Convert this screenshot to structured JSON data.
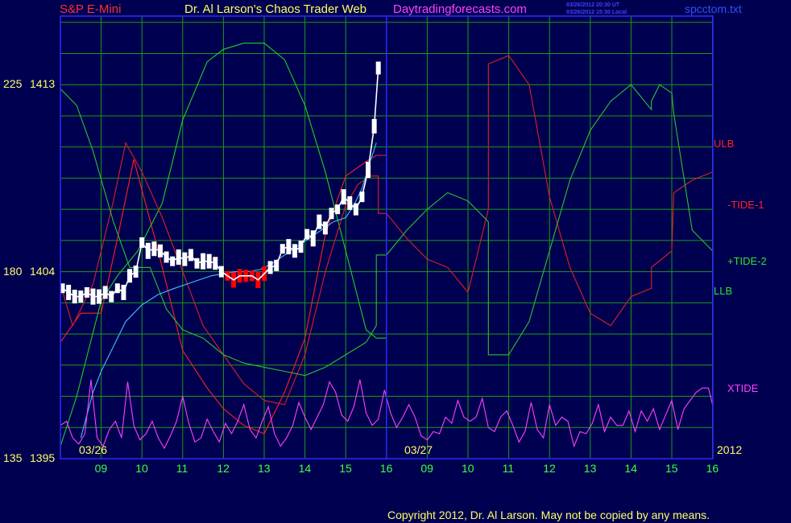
{
  "header": {
    "instrument": "S&P E-Mini",
    "title": "Dr. Al Larson's Chaos Trader Web",
    "site": "Daytradingforecasts.com",
    "stamp_ut": "03/26/2012 20:30 UT",
    "stamp_local": "03/26/2012 15:30 Local",
    "filename": "spcctom.txt"
  },
  "footer": {
    "copyright": "Copyright 2012, Dr. Al Larson. May not be copied by any means."
  },
  "colors": {
    "background": "#000050",
    "grid": "#1a9a1a",
    "frame": "#2a2aff",
    "price": "#ffffff",
    "price_down": "#ff0000",
    "ulb": "#ff2020",
    "llb": "#20d020",
    "tide_minus_1": "#dd2020",
    "tide_plus_2": "#30c030",
    "xtide": "#ff40ff",
    "average": "#40c0ff",
    "day_label": "#ffff66",
    "hour_label": "#40ff40"
  },
  "chart_data": {
    "type": "line",
    "title": "S&P E-Mini",
    "y_axis": {
      "ticks": [
        {
          "left": "225",
          "right": "1413",
          "value": 1413
        },
        {
          "left": "180",
          "right": "1404",
          "value": 1404
        },
        {
          "left": "135",
          "right": "1395",
          "value": 1395
        }
      ],
      "ylim": [
        1395,
        1416.3
      ]
    },
    "x_axis": {
      "hour_ticks": [
        "09",
        "10",
        "11",
        "12",
        "13",
        "14",
        "15",
        "16",
        "09",
        "10",
        "11",
        "12",
        "13",
        "14",
        "15",
        "16"
      ],
      "day_labels": [
        "03/26",
        "03/27"
      ],
      "year_label": "2012",
      "x_range": [
        0,
        16
      ]
    },
    "grid": true,
    "series_labels": {
      "ulb": "ULB",
      "tide_minus_1": "-TIDE-1",
      "tide_plus_2": "+TIDE-2",
      "llb": "LLB",
      "xtide": "XTIDE"
    },
    "series": [
      {
        "key": "ulb",
        "x": [
          0,
          0.5,
          1.0,
          1.4,
          1.8,
          2.4,
          3.0,
          3.6,
          4.0,
          4.5,
          5.0,
          5.5,
          6.0,
          6.5,
          7.0,
          7.5,
          7.75,
          8.0
        ],
        "y": [
          1400.6,
          1402.0,
          1402.0,
          1405.6,
          1409.4,
          1405.0,
          1400.2,
          1398.4,
          1397.4,
          1396.6,
          1396.2,
          1398.2,
          1400.8,
          1405.8,
          1408.6,
          1409.3,
          1409.6,
          1409.6
        ]
      },
      {
        "key": "llb",
        "x": [
          0,
          0.4,
          1.0,
          1.4,
          1.9,
          2.5,
          3.0,
          3.6,
          4.0,
          4.5,
          5.0,
          5.5,
          6.0,
          6.5,
          7.0,
          7.5,
          7.75,
          8.0
        ],
        "y": [
          1395.6,
          1398.0,
          1402.6,
          1403.8,
          1405.0,
          1407.3,
          1411.3,
          1414.1,
          1414.7,
          1415.0,
          1415.0,
          1414.2,
          1412.0,
          1408.8,
          1405.0,
          1401.2,
          1400.8,
          1400.8
        ]
      },
      {
        "key": "tide_minus_1",
        "x": [
          0,
          0.3,
          0.8,
          1.3,
          1.6,
          2.0,
          2.5,
          3.0,
          3.5,
          4.0,
          4.5,
          5.0,
          5.5,
          6.0,
          6.5,
          7.0,
          7.3,
          7.6,
          7.8,
          7.8,
          8.0,
          8.5,
          9.0,
          9.5,
          10.0,
          10.5,
          10.5,
          11.0,
          11.5,
          12.0,
          12.5,
          13.0,
          13.5,
          14.0,
          14.5,
          14.5,
          15.0,
          15.05,
          15.5,
          16.0
        ],
        "y": [
          1403.4,
          1401.4,
          1403.4,
          1407.4,
          1410.2,
          1408.8,
          1406.6,
          1404.0,
          1401.4,
          1400.0,
          1398.6,
          1397.8,
          1397.6,
          1400.0,
          1404.0,
          1407.2,
          1408.2,
          1408.6,
          1408.6,
          1406.8,
          1406.8,
          1405.6,
          1404.6,
          1404.2,
          1403.0,
          1407.0,
          1414.0,
          1414.4,
          1413.0,
          1407.6,
          1404.2,
          1402.0,
          1401.4,
          1402.8,
          1403.2,
          1404.2,
          1405.0,
          1407.8,
          1408.4,
          1408.8
        ]
      },
      {
        "key": "tide_plus_2",
        "x": [
          0,
          0.4,
          0.8,
          1.3,
          1.7,
          2.2,
          2.6,
          3.0,
          3.5,
          4.0,
          4.5,
          5.0,
          5.5,
          6.0,
          6.5,
          7.0,
          7.5,
          7.75,
          7.75,
          8.0,
          8.5,
          9.0,
          9.5,
          10.0,
          10.5,
          10.5,
          11.0,
          11.5,
          12.0,
          12.5,
          13.0,
          13.5,
          14.0,
          14.5,
          14.5,
          14.7,
          15.0,
          15.05,
          15.5,
          16.0
        ],
        "y": [
          1412.8,
          1412.0,
          1409.8,
          1406.4,
          1404.2,
          1404.2,
          1402.2,
          1401.2,
          1400.8,
          1400.0,
          1399.6,
          1399.4,
          1399.2,
          1399.0,
          1399.4,
          1400.0,
          1400.6,
          1401.4,
          1404.8,
          1404.8,
          1406.0,
          1407.0,
          1407.8,
          1407.4,
          1406.4,
          1400.0,
          1400.0,
          1401.6,
          1405.0,
          1408.4,
          1410.8,
          1412.2,
          1413.0,
          1411.8,
          1412.2,
          1413.0,
          1412.6,
          1411.6,
          1406.0,
          1405.0
        ]
      },
      {
        "key": "average",
        "x": [
          0.5,
          0.8,
          1.0,
          1.3,
          1.6,
          2.0,
          2.4,
          2.8,
          3.1,
          3.4,
          3.7,
          4.0,
          4.3,
          4.6,
          4.9,
          5.2,
          5.5,
          5.8,
          6.1,
          6.4,
          6.7,
          7.0,
          7.2,
          7.4,
          7.6,
          7.75
        ],
        "y": [
          1396.0,
          1398.2,
          1399.2,
          1400.4,
          1401.6,
          1402.4,
          1402.9,
          1403.2,
          1403.4,
          1403.6,
          1403.8,
          1403.9,
          1404.0,
          1404.0,
          1404.1,
          1404.4,
          1404.8,
          1405.2,
          1405.6,
          1406.0,
          1406.4,
          1406.6,
          1407.2,
          1408.0,
          1409.3,
          1410.2
        ]
      },
      {
        "key": "xtide",
        "x": [
          0,
          0.15,
          0.3,
          0.45,
          0.6,
          0.75,
          0.9,
          1.05,
          1.2,
          1.35,
          1.5,
          1.65,
          1.8,
          1.95,
          2.1,
          2.25,
          2.4,
          2.55,
          2.7,
          2.85,
          3.0,
          3.15,
          3.3,
          3.45,
          3.6,
          3.75,
          3.9,
          4.05,
          4.2,
          4.35,
          4.5,
          4.65,
          4.8,
          4.95,
          5.1,
          5.25,
          5.4,
          5.55,
          5.7,
          5.85,
          6.0,
          6.15,
          6.3,
          6.45,
          6.6,
          6.75,
          6.9,
          7.05,
          7.2,
          7.35,
          7.5,
          7.65,
          7.8,
          7.95,
          8.1,
          8.25,
          8.4,
          8.55,
          8.7,
          8.85,
          9.0,
          9.15,
          9.3,
          9.45,
          9.6,
          9.75,
          9.9,
          10.05,
          10.2,
          10.35,
          10.5,
          10.65,
          10.8,
          10.95,
          11.1,
          11.25,
          11.4,
          11.55,
          11.7,
          11.85,
          12.0,
          12.15,
          12.3,
          12.45,
          12.6,
          12.75,
          12.9,
          13.05,
          13.2,
          13.35,
          13.5,
          13.65,
          13.8,
          13.95,
          14.1,
          14.25,
          14.4,
          14.55,
          14.7,
          14.85,
          15.0,
          15.15,
          15.3,
          15.45,
          15.6,
          15.75,
          15.9,
          16.0
        ],
        "y": [
          1396.6,
          1396.8,
          1396.0,
          1395.7,
          1396.2,
          1398.8,
          1396.0,
          1395.6,
          1396.4,
          1396.8,
          1396.0,
          1398.7,
          1396.6,
          1395.9,
          1396.2,
          1396.8,
          1396.0,
          1395.5,
          1396.1,
          1396.8,
          1398.0,
          1396.7,
          1395.8,
          1396.0,
          1396.9,
          1396.3,
          1395.8,
          1396.7,
          1396.2,
          1396.8,
          1397.6,
          1396.4,
          1396.0,
          1396.8,
          1397.5,
          1396.2,
          1395.6,
          1396.0,
          1396.6,
          1397.7,
          1397.0,
          1396.4,
          1397.0,
          1397.6,
          1398.7,
          1398.2,
          1397.1,
          1396.8,
          1397.5,
          1398.8,
          1397.2,
          1396.6,
          1396.9,
          1398.3,
          1397.2,
          1396.5,
          1397.0,
          1397.6,
          1397.0,
          1396.1,
          1395.9,
          1396.3,
          1396.2,
          1397.0,
          1396.7,
          1397.8,
          1397.0,
          1396.8,
          1397.0,
          1397.9,
          1396.5,
          1396.3,
          1397.0,
          1397.3,
          1396.6,
          1395.8,
          1396.3,
          1397.7,
          1396.4,
          1396.0,
          1397.6,
          1396.6,
          1397.0,
          1396.8,
          1395.6,
          1396.3,
          1396.2,
          1396.7,
          1397.6,
          1396.3,
          1397.0,
          1396.6,
          1396.6,
          1397.3,
          1396.3,
          1397.3,
          1396.8,
          1397.4,
          1396.4,
          1397.1,
          1397.8,
          1396.4,
          1397.4,
          1397.8,
          1398.2,
          1398.4,
          1398.4,
          1397.6
        ]
      },
      {
        "key": "price",
        "x": [
          0.05,
          0.2,
          0.35,
          0.5,
          0.65,
          0.8,
          0.95,
          1.1,
          1.25,
          1.4,
          1.55,
          1.7,
          1.85,
          2.0,
          2.15,
          2.3,
          2.45,
          2.6,
          2.75,
          2.9,
          3.05,
          3.2,
          3.35,
          3.5,
          3.65,
          3.8,
          3.95,
          4.1,
          4.25,
          4.4,
          4.55,
          4.7,
          4.85,
          5.0,
          5.15,
          5.3,
          5.45,
          5.6,
          5.75,
          5.9,
          6.05,
          6.2,
          6.35,
          6.5,
          6.65,
          6.8,
          6.95,
          7.1,
          7.25,
          7.4,
          7.55,
          7.7,
          7.8
        ],
        "y": [
          1403.2,
          1403.0,
          1402.8,
          1402.8,
          1403.0,
          1402.8,
          1402.8,
          1403.0,
          1402.8,
          1403.2,
          1403.0,
          1403.8,
          1404.0,
          1405.4,
          1405.0,
          1405.1,
          1405.0,
          1404.7,
          1404.5,
          1404.7,
          1404.6,
          1404.8,
          1404.4,
          1404.5,
          1404.5,
          1404.4,
          1404.0,
          1403.8,
          1403.6,
          1403.8,
          1403.8,
          1403.8,
          1403.6,
          1403.9,
          1404.2,
          1404.3,
          1405.1,
          1405.2,
          1405.0,
          1405.2,
          1405.8,
          1405.6,
          1406.4,
          1406.1,
          1406.8,
          1407.0,
          1407.6,
          1407.3,
          1407.0,
          1407.6,
          1408.9,
          1411.0,
          1413.8
        ]
      }
    ]
  }
}
